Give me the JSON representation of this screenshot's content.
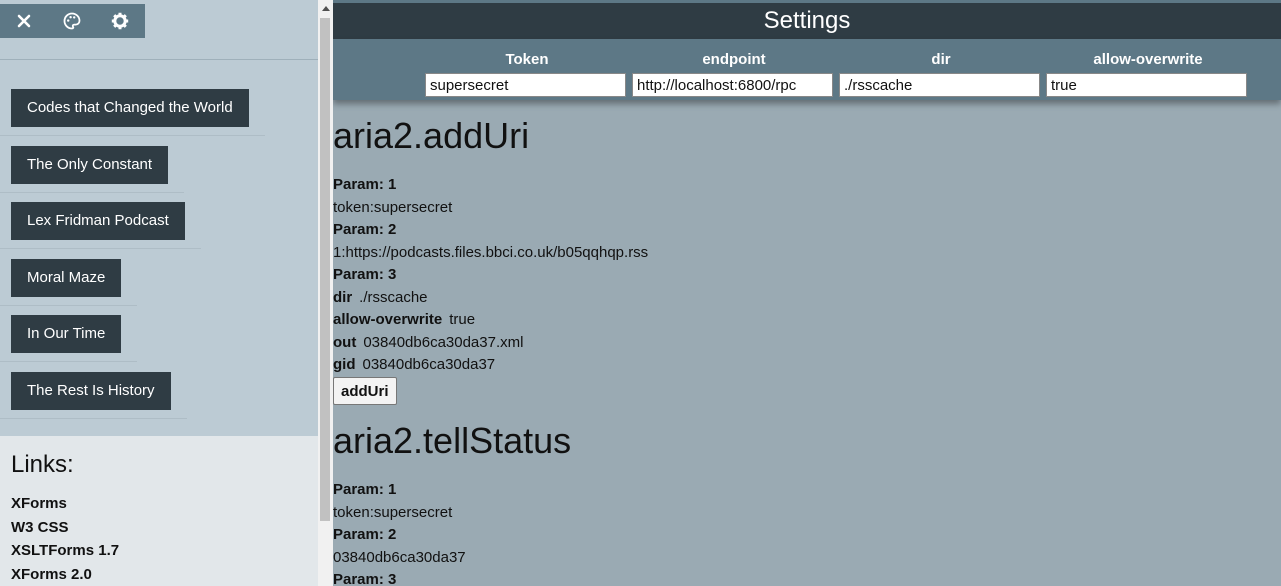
{
  "sidebar": {
    "top_icons": [
      "close-icon",
      "palette-icon",
      "gear-icon"
    ],
    "feeds": [
      {
        "label": "Codes that Changed the World"
      },
      {
        "label": "The Only Constant"
      },
      {
        "label": "Lex Fridman Podcast"
      },
      {
        "label": "Moral Maze"
      },
      {
        "label": "In Our Time"
      },
      {
        "label": "The Rest Is History"
      }
    ],
    "links_title": "Links:",
    "links": [
      {
        "label": "XForms"
      },
      {
        "label": "W3 CSS"
      },
      {
        "label": "XSLTForms 1.7"
      },
      {
        "label": "XForms 2.0"
      }
    ]
  },
  "settings": {
    "title": "Settings",
    "columns": [
      {
        "header": "Token",
        "value": "supersecret"
      },
      {
        "header": "endpoint",
        "value": "http://localhost:6800/rpc"
      },
      {
        "header": "dir",
        "value": "./rsscache"
      },
      {
        "header": "allow-overwrite",
        "value": "true"
      }
    ]
  },
  "adduri": {
    "title": "aria2.addUri",
    "param1_label": "Param: 1",
    "param1_value": "token:supersecret",
    "param2_label": "Param: 2",
    "param2_value": "1:https://podcasts.files.bbci.co.uk/b05qqhqp.rss",
    "param3_label": "Param: 3",
    "options": [
      {
        "key": "dir",
        "value": "./rsscache"
      },
      {
        "key": "allow-overwrite",
        "value": "true"
      },
      {
        "key": "out",
        "value": "03840db6ca30da37.xml"
      },
      {
        "key": "gid",
        "value": "03840db6ca30da37"
      }
    ],
    "button_label": "addUri"
  },
  "tellstatus": {
    "title": "aria2.tellStatus",
    "param1_label": "Param: 1",
    "param1_value": "token:supersecret",
    "param2_label": "Param: 2",
    "param2_value": "03840db6ca30da37",
    "param3_label": "Param: 3"
  }
}
